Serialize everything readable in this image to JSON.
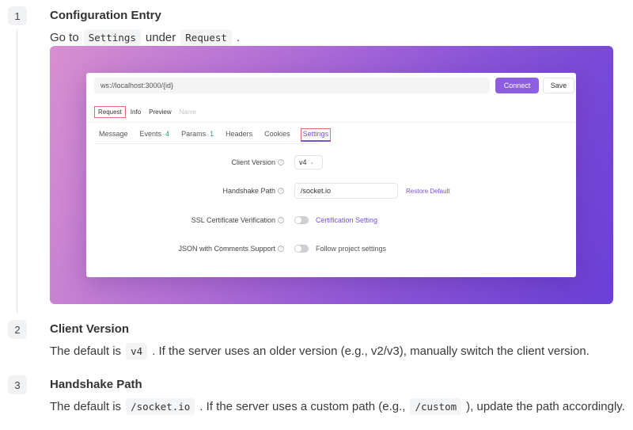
{
  "steps": [
    {
      "number": "1",
      "title": "Configuration Entry",
      "text_before": "Go to",
      "code1": "Settings",
      "text_middle": "under",
      "code2": "Request",
      "text_after": "."
    },
    {
      "number": "2",
      "title": "Client Version",
      "text_before": "The default is",
      "code1": "v4",
      "text_after": ". If the server uses an older version (e.g., v2/v3), manually switch the client version."
    },
    {
      "number": "3",
      "title": "Handshake Path",
      "text_before": "The default is",
      "code1": "/socket.io",
      "text_middle": ". If the server uses a custom path (e.g.,",
      "code2": "/custom",
      "text_after": "), update the path accordingly."
    }
  ],
  "app": {
    "url": "ws://localhost:3000/{id}",
    "connect_label": "Connect",
    "save_label": "Save",
    "subtabs": [
      "Request",
      "Info",
      "Preview",
      "Name"
    ],
    "tabs": [
      {
        "label": "Message",
        "count": ""
      },
      {
        "label": "Events",
        "count": "4"
      },
      {
        "label": "Params",
        "count": "1"
      },
      {
        "label": "Headers",
        "count": ""
      },
      {
        "label": "Cookies",
        "count": ""
      },
      {
        "label": "Settings",
        "count": ""
      }
    ],
    "settings": {
      "client_version_label": "Client Version",
      "client_version_value": "v4",
      "handshake_path_label": "Handshake Path",
      "handshake_path_value": "/socket.io",
      "restore_default": "Restore Default",
      "ssl_label": "SSL Certificate Verification",
      "ssl_link": "Certification Setting",
      "json_label": "JSON with Comments Support",
      "json_text": "Follow project settings"
    }
  },
  "colors": {
    "accent": "#8e5ee0",
    "gradient_start": "#d88fd0",
    "gradient_end": "#6b3fd6"
  }
}
